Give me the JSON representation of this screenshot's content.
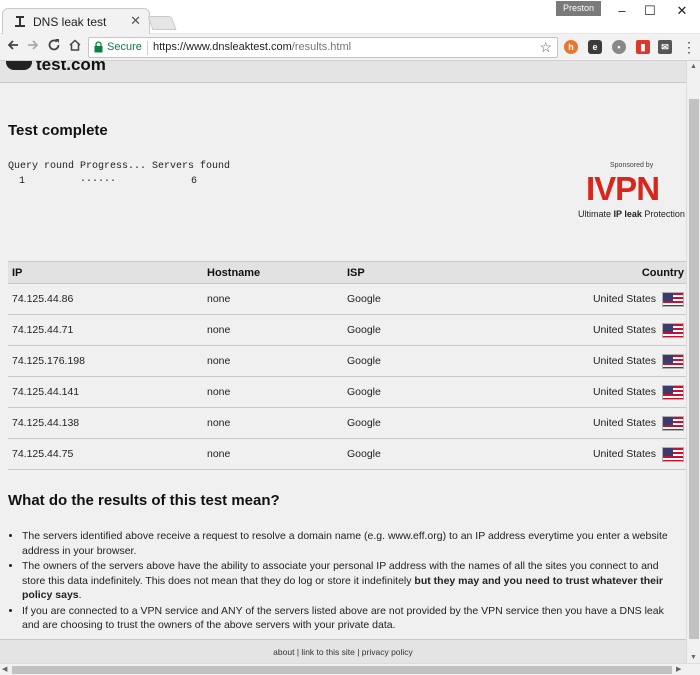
{
  "browser": {
    "tab_title": "DNS leak test",
    "tab_close": "✕",
    "profile_name": "Preston",
    "window_minimize": "–",
    "window_maximize": "☐",
    "window_close": "✕",
    "secure_label": "Secure",
    "url_host": "https://www.dnsleaktest.com",
    "url_path": "/results.html",
    "icons": [
      "back-icon",
      "forward-icon",
      "reload-icon",
      "home-icon",
      "lock-icon",
      "star-icon"
    ]
  },
  "site": {
    "logo_text": "test.com"
  },
  "main": {
    "title": "Test complete",
    "progress_header": "Query round Progress... Servers found",
    "progress_round": "1",
    "progress_dots": "......",
    "progress_servers": "6",
    "sponsor_label": "Sponsored by",
    "sponsor_name": "IVPN",
    "sponsor_tagline_prefix": "Ultimate ",
    "sponsor_tagline_bold": "IP leak",
    "sponsor_tagline_suffix": " Protection"
  },
  "table": {
    "headers": [
      "IP",
      "Hostname",
      "ISP",
      "Country"
    ],
    "rows": [
      {
        "ip": "74.125.44.86",
        "hostname": "none",
        "isp": "Google",
        "country": "United States"
      },
      {
        "ip": "74.125.44.71",
        "hostname": "none",
        "isp": "Google",
        "country": "United States"
      },
      {
        "ip": "74.125.176.198",
        "hostname": "none",
        "isp": "Google",
        "country": "United States"
      },
      {
        "ip": "74.125.44.141",
        "hostname": "none",
        "isp": "Google",
        "country": "United States"
      },
      {
        "ip": "74.125.44.138",
        "hostname": "none",
        "isp": "Google",
        "country": "United States"
      },
      {
        "ip": "74.125.44.75",
        "hostname": "none",
        "isp": "Google",
        "country": "United States"
      }
    ]
  },
  "explanation": {
    "title": "What do the results of this test mean?",
    "bullet_1": "The servers identified above receive a request to resolve a domain name (e.g. www.eff.org) to an IP address everytime you enter a website address in your browser.",
    "bullet_2_normal": "The owners of the servers above have the ability to associate your personal IP address with the names of all the sites you connect to and store this data indefinitely. This does not mean that they do log or store it indefinitely ",
    "bullet_2_bold": "but they may and you need to trust whatever their policy says",
    "bullet_2_end": ".",
    "bullet_3": "If you are connected to a VPN service and ANY of the servers listed above are not provided by the VPN service then you have a DNS leak and are choosing to trust the owners of the above servers with your private data."
  },
  "footer": {
    "about": "about",
    "link": "link to this site",
    "privacy": "privacy policy",
    "separator": "|"
  }
}
